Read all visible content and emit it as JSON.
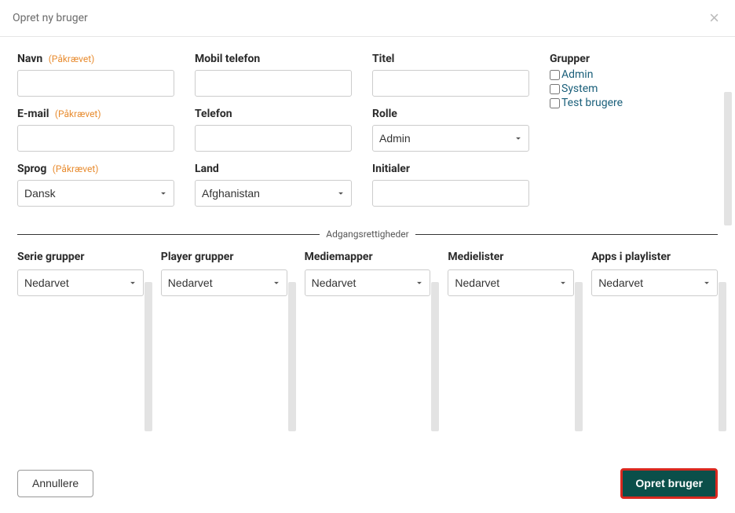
{
  "modal": {
    "title": "Opret ny bruger",
    "close": "×"
  },
  "fields": {
    "name": {
      "label": "Navn",
      "required": "(Påkrævet)",
      "value": ""
    },
    "email": {
      "label": "E-mail",
      "required": "(Påkrævet)",
      "value": ""
    },
    "language": {
      "label": "Sprog",
      "required": "(Påkrævet)",
      "selected": "Dansk"
    },
    "mobile": {
      "label": "Mobil telefon",
      "value": ""
    },
    "phone": {
      "label": "Telefon",
      "value": ""
    },
    "country": {
      "label": "Land",
      "selected": "Afghanistan"
    },
    "title": {
      "label": "Titel",
      "value": ""
    },
    "role": {
      "label": "Rolle",
      "selected": "Admin"
    },
    "initials": {
      "label": "Initialer",
      "value": ""
    }
  },
  "groups": {
    "label": "Grupper",
    "items": [
      {
        "label": "Admin",
        "checked": false
      },
      {
        "label": "System",
        "checked": false
      },
      {
        "label": "Test brugere",
        "checked": false
      }
    ]
  },
  "permissions": {
    "divider_label": "Adgangsrettigheder",
    "columns": {
      "series": {
        "label": "Serie grupper",
        "selected": "Nedarvet"
      },
      "player": {
        "label": "Player grupper",
        "selected": "Nedarvet"
      },
      "media_folders": {
        "label": "Mediemapper",
        "selected": "Nedarvet"
      },
      "media_lists": {
        "label": "Medielister",
        "selected": "Nedarvet"
      },
      "apps": {
        "label": "Apps i playlister",
        "selected": "Nedarvet"
      }
    }
  },
  "footer": {
    "cancel": "Annullere",
    "submit": "Opret bruger"
  }
}
